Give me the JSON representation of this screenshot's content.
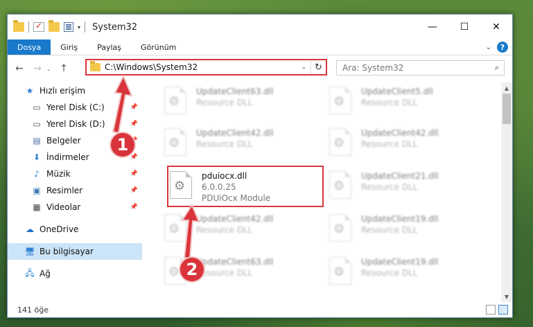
{
  "window": {
    "title": "System32",
    "controls": {
      "minimize": "—",
      "maximize": "☐",
      "close": "✕"
    }
  },
  "ribbon": {
    "tabs": [
      "Dosya",
      "Giriş",
      "Paylaş",
      "Görünüm"
    ],
    "help": "?"
  },
  "navbar": {
    "address": "C:\\Windows\\System32",
    "search_placeholder": "Ara: System32"
  },
  "sidebar": {
    "items": [
      {
        "label": "Hızlı erişim",
        "icon": "star-icon",
        "pinned": false
      },
      {
        "label": "Yerel Disk (C:)",
        "icon": "drive-icon",
        "pinned": true
      },
      {
        "label": "Yerel Disk (D:)",
        "icon": "drive-icon",
        "pinned": true
      },
      {
        "label": "Belgeler",
        "icon": "documents-icon",
        "pinned": true
      },
      {
        "label": "İndirmeler",
        "icon": "download-icon",
        "pinned": true
      },
      {
        "label": "Müzik",
        "icon": "music-icon",
        "pinned": true
      },
      {
        "label": "Resimler",
        "icon": "pictures-icon",
        "pinned": true
      },
      {
        "label": "Videolar",
        "icon": "videos-icon",
        "pinned": true
      },
      {
        "label": "OneDrive",
        "icon": "cloud-icon"
      },
      {
        "label": "Bu bilgisayar",
        "icon": "computer-icon",
        "selected": true
      },
      {
        "label": "Ağ",
        "icon": "network-icon"
      }
    ]
  },
  "files": {
    "row1": [
      {
        "name": "UpdateClient63.dll",
        "meta": "Resource DLL"
      },
      {
        "name": "UpdateClient5.dll",
        "meta": "Resource DLL"
      }
    ],
    "row2": [
      {
        "name": "UpdateClient42.dll",
        "meta": "Resource DLL"
      },
      {
        "name": "UpdateClient42.dll",
        "meta": "Resource DLL"
      }
    ],
    "highlighted": {
      "name": "pduiocx.dll",
      "version": "6.0.0.25",
      "description": "PDUiOcx Module"
    },
    "row3_right": {
      "name": "UpdateClient21.dll",
      "meta": "Resource DLL"
    },
    "row4": [
      {
        "name": "UpdateClient42.dll",
        "meta": "Resource DLL"
      },
      {
        "name": "UpdateClient19.dll",
        "meta": "Resource DLL"
      }
    ],
    "row5": [
      {
        "name": "UpdateClient63.dll",
        "meta": "Resource DLL"
      },
      {
        "name": "UpdateClient19.dll",
        "meta": "Resource DLL"
      }
    ]
  },
  "status": {
    "count": "141 öğe"
  },
  "annotations": {
    "step1": "1",
    "step2": "2",
    "color": "#d9343b"
  }
}
